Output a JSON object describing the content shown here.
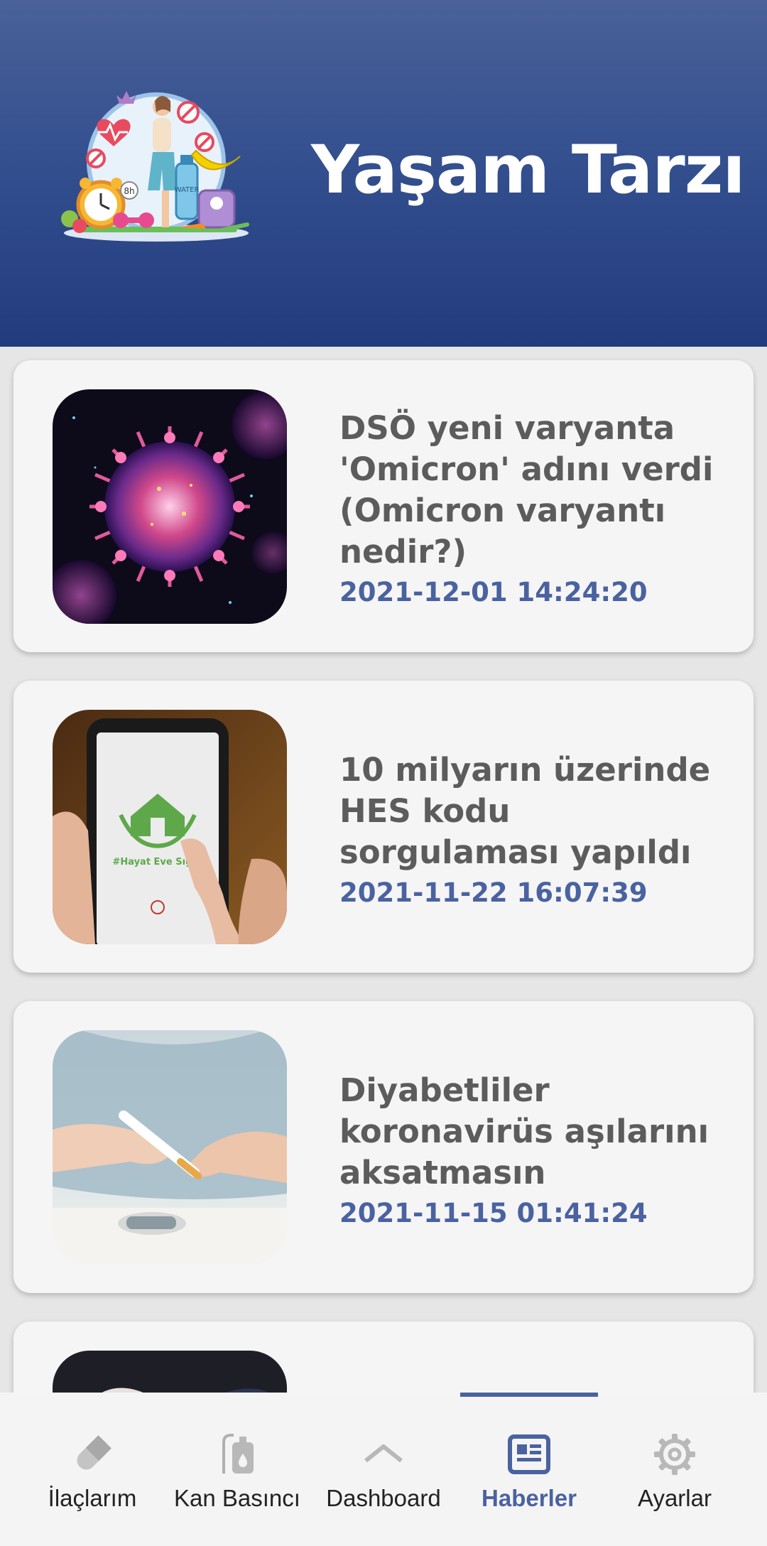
{
  "header": {
    "title": "Yaşam Tarzı"
  },
  "news": [
    {
      "title": "DSÖ yeni varyanta 'Omicron' adını verdi (Omicron varyantı nedir?)",
      "date": "2021-12-01 14:24:20"
    },
    {
      "title": "10 milyarın üzerinde HES kodu sorgulaması yapıldı",
      "date": "2021-11-22 16:07:39"
    },
    {
      "title": "Diyabetliler koronavirüs aşılarını aksatmasın",
      "date": "2021-11-15 01:41:24"
    }
  ],
  "nav": [
    {
      "label": "İlaçlarım",
      "icon": "pill-icon"
    },
    {
      "label": "Kan Basıncı",
      "icon": "blood-bag-icon"
    },
    {
      "label": "Dashboard",
      "icon": "chevron-up-icon"
    },
    {
      "label": "Haberler",
      "icon": "newspaper-icon",
      "active": true
    },
    {
      "label": "Ayarlar",
      "icon": "gear-icon"
    }
  ],
  "colors": {
    "accent": "#4a62a0",
    "header_top": "#4a6199",
    "header_bottom": "#223b7d",
    "title_text": "#5c5c5c"
  }
}
